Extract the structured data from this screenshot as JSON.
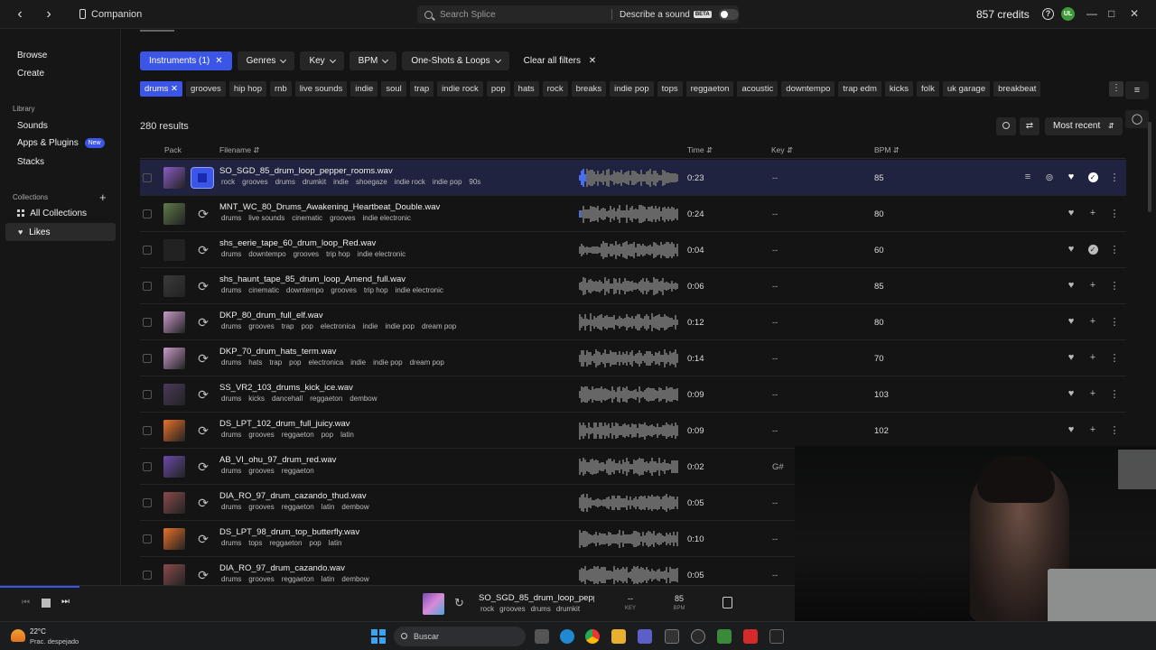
{
  "topbar": {
    "companion_label": "Companion",
    "search_placeholder": "Search Splice",
    "describe_label": "Describe a sound",
    "beta_label": "BETA",
    "credits": "857 credits",
    "help": "?",
    "avatar_initials": "UL"
  },
  "sidebar": {
    "browse": "Browse",
    "create": "Create",
    "library_heading": "Library",
    "sounds": "Sounds",
    "apps_plugins": "Apps & Plugins",
    "new_badge": "New",
    "stacks": "Stacks",
    "collections_heading": "Collections",
    "all_collections": "All Collections",
    "likes": "Likes"
  },
  "filters": {
    "instruments": "Instruments (1)",
    "genres": "Genres",
    "key": "Key",
    "bpm": "BPM",
    "oneshots": "One-Shots & Loops",
    "clear": "Clear all filters"
  },
  "tags": [
    "drums",
    "grooves",
    "hip hop",
    "rnb",
    "live sounds",
    "indie",
    "soul",
    "trap",
    "indie rock",
    "pop",
    "hats",
    "rock",
    "breaks",
    "indie pop",
    "tops",
    "reggaeton",
    "acoustic",
    "downtempo",
    "trap edm",
    "kicks",
    "folk",
    "uk garage",
    "breakbeat"
  ],
  "results": {
    "count": "280 results",
    "sort": "Most recent"
  },
  "columns": {
    "pack": "Pack",
    "filename": "Filename",
    "time": "Time",
    "key": "Key",
    "bpm": "BPM"
  },
  "rows": [
    {
      "name": "SO_SGD_85_drum_loop_pepper_rooms.wav",
      "tags": [
        "rock",
        "grooves",
        "drums",
        "drumkit",
        "indie",
        "shoegaze",
        "indie rock",
        "indie pop",
        "90s"
      ],
      "time": "0:23",
      "key": "--",
      "bpm": "85",
      "art": "#8a5cc4",
      "liked": true,
      "added": true,
      "selected": true
    },
    {
      "name": "MNT_WC_80_Drums_Awakening_Heartbeat_Double.wav",
      "tags": [
        "drums",
        "live sounds",
        "cinematic",
        "grooves",
        "indie electronic"
      ],
      "time": "0:24",
      "key": "--",
      "bpm": "80",
      "art": "#5f7a4a",
      "liked": false,
      "added": false,
      "selected": false
    },
    {
      "name": "shs_eerie_tape_60_drum_loop_Red.wav",
      "tags": [
        "drums",
        "downtempo",
        "grooves",
        "trip hop",
        "indie electronic"
      ],
      "time": "0:04",
      "key": "--",
      "bpm": "60",
      "art": "#222222",
      "liked": false,
      "added": true,
      "selected": false
    },
    {
      "name": "shs_haunt_tape_85_drum_loop_Amend_full.wav",
      "tags": [
        "drums",
        "cinematic",
        "downtempo",
        "grooves",
        "trip hop",
        "indie electronic"
      ],
      "time": "0:06",
      "key": "--",
      "bpm": "85",
      "art": "#3a3a3a",
      "liked": false,
      "added": false,
      "selected": false
    },
    {
      "name": "DKP_80_drum_full_elf.wav",
      "tags": [
        "drums",
        "grooves",
        "trap",
        "pop",
        "electronica",
        "indie",
        "indie pop",
        "dream pop"
      ],
      "time": "0:12",
      "key": "--",
      "bpm": "80",
      "art": "#c89ac8",
      "liked": false,
      "added": false,
      "selected": false
    },
    {
      "name": "DKP_70_drum_hats_term.wav",
      "tags": [
        "drums",
        "hats",
        "trap",
        "pop",
        "electronica",
        "indie",
        "indie pop",
        "dream pop"
      ],
      "time": "0:14",
      "key": "--",
      "bpm": "70",
      "art": "#c89ac8",
      "liked": false,
      "added": false,
      "selected": false
    },
    {
      "name": "SS_VR2_103_drums_kick_ice.wav",
      "tags": [
        "drums",
        "kicks",
        "dancehall",
        "reggaeton",
        "dembow"
      ],
      "time": "0:09",
      "key": "--",
      "bpm": "103",
      "art": "#4a3a5a",
      "liked": false,
      "added": false,
      "selected": false
    },
    {
      "name": "DS_LPT_102_drum_full_juicy.wav",
      "tags": [
        "drums",
        "grooves",
        "reggaeton",
        "pop",
        "latin"
      ],
      "time": "0:09",
      "key": "--",
      "bpm": "102",
      "art": "#e8702a",
      "liked": false,
      "added": false,
      "selected": false
    },
    {
      "name": "AB_VI_ohu_97_drum_red.wav",
      "tags": [
        "drums",
        "grooves",
        "reggaeton"
      ],
      "time": "0:02",
      "key": "G#",
      "bpm": "",
      "art": "#6a4aa8",
      "liked": false,
      "added": false,
      "selected": false
    },
    {
      "name": "DIA_RO_97_drum_cazando_thud.wav",
      "tags": [
        "drums",
        "grooves",
        "reggaeton",
        "latin",
        "dembow"
      ],
      "time": "0:05",
      "key": "--",
      "bpm": "",
      "art": "#8a4a4a",
      "liked": false,
      "added": false,
      "selected": false
    },
    {
      "name": "DS_LPT_98_drum_top_butterfly.wav",
      "tags": [
        "drums",
        "tops",
        "reggaeton",
        "pop",
        "latin"
      ],
      "time": "0:10",
      "key": "--",
      "bpm": "",
      "art": "#e8702a",
      "liked": false,
      "added": false,
      "selected": false
    },
    {
      "name": "DIA_RO_97_drum_cazando.wav",
      "tags": [
        "drums",
        "grooves",
        "reggaeton",
        "latin",
        "dembow"
      ],
      "time": "0:05",
      "key": "--",
      "bpm": "",
      "art": "#8a4a4a",
      "liked": false,
      "added": false,
      "selected": false
    }
  ],
  "player": {
    "name": "SO_SGD_85_drum_loop_pepper_rooms.wav",
    "tags": [
      "rock",
      "grooves",
      "drums",
      "drumkit"
    ],
    "key": "--",
    "key_label": "KEY",
    "bpm": "85",
    "bpm_label": "BPM",
    "progress": 0.1
  },
  "taskbar": {
    "temp": "22°C",
    "weather": "Prac. despejado",
    "search": "Buscar"
  }
}
